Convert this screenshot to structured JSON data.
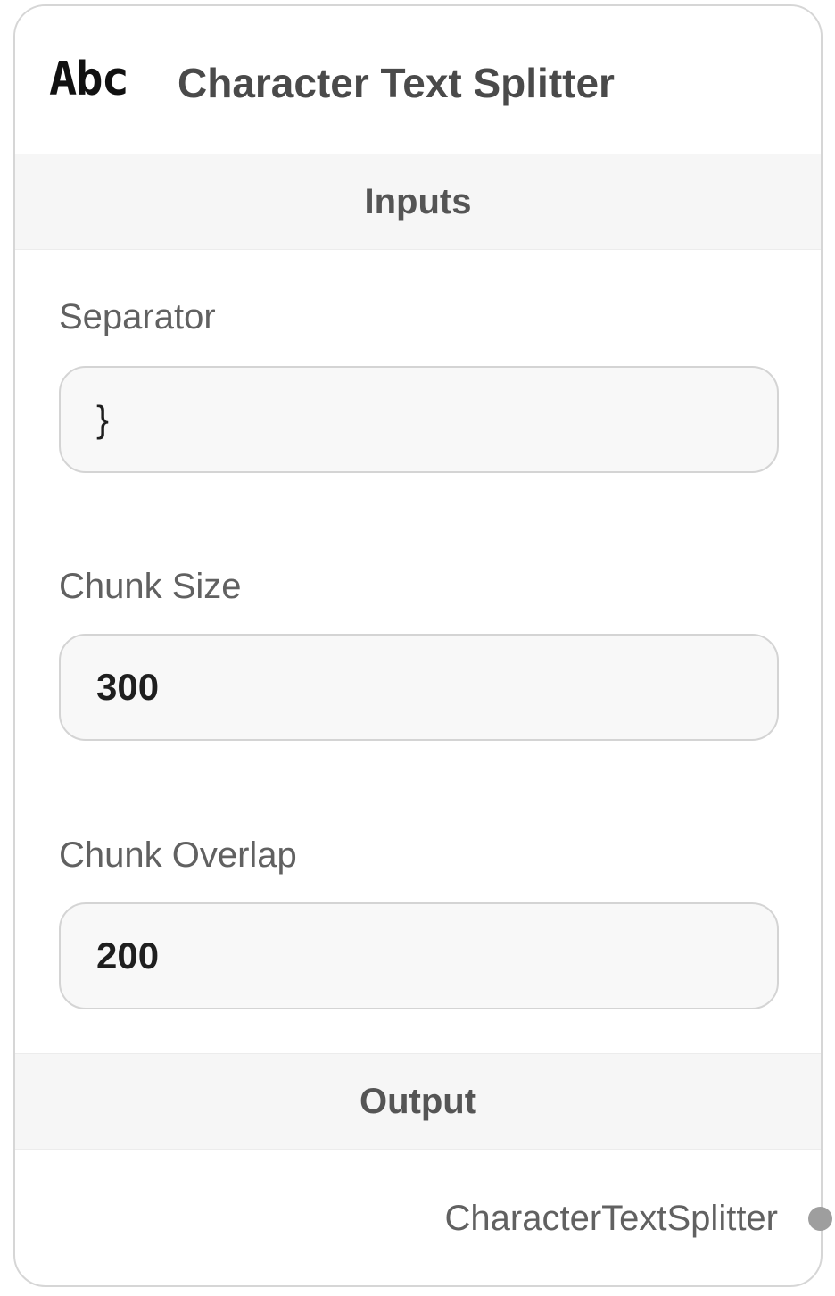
{
  "node": {
    "icon": "abc-icon",
    "icon_text": "Abc",
    "title": "Character Text Splitter"
  },
  "inputs_header": "Inputs",
  "fields": [
    {
      "label": "Separator",
      "value": "}"
    },
    {
      "label": "Chunk Size",
      "value": "300"
    },
    {
      "label": "Chunk Overlap",
      "value": "200"
    }
  ],
  "output_header": "Output",
  "output": {
    "label": "CharacterTextSplitter",
    "handle_icon": "connection-handle"
  },
  "colors": {
    "border": "#d6d6d6",
    "section_bg": "#f6f6f6",
    "input_bg": "#f8f8f8",
    "handle": "#9e9e9e"
  }
}
